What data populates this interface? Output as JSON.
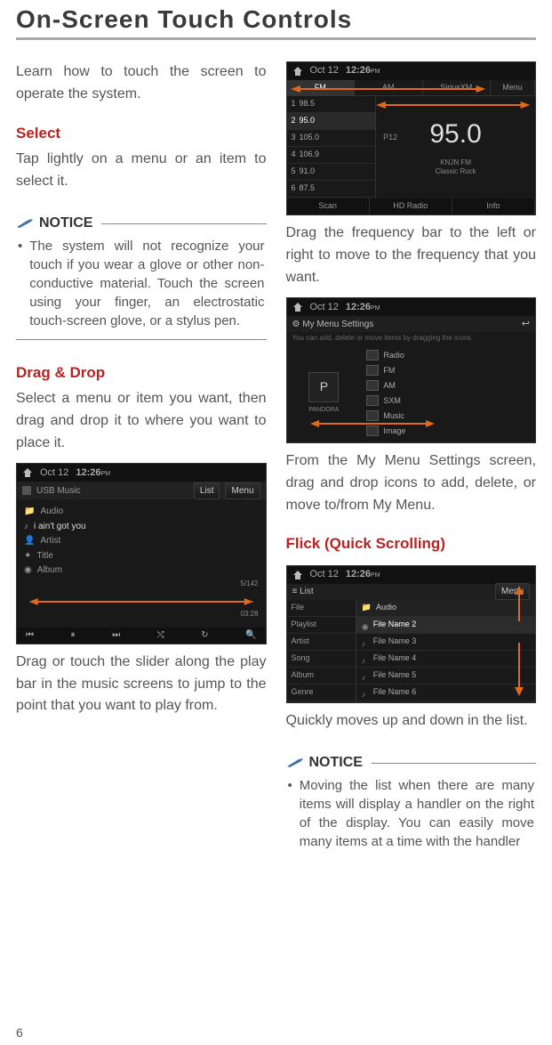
{
  "page": {
    "title": "On-Screen Touch Controls",
    "number": "6"
  },
  "left": {
    "intro": "Learn how to touch the screen to operate the system.",
    "select_title": "Select",
    "select_body": "Tap lightly on a menu or an item to select it.",
    "notice_label": "NOTICE",
    "notice1": "The system will not recognize your touch if you wear a glove or other non-conductive material. Touch the screen using your finger, an electrostatic touch-screen glove, or a stylus pen.",
    "drag_title": "Drag & Drop",
    "drag_body": "Select a menu or item you want, then drag and drop it to where you want to place it.",
    "drag_caption": "Drag or touch the slider along the play bar in the music screens to jump to the point that you want to play from."
  },
  "right": {
    "radio_caption": "Drag the frequency bar to the left or right to move to the frequency that you want.",
    "mymenu_caption": "From the My Menu Settings screen, drag and drop icons to add, delete, or move to/from My Menu.",
    "flick_title": "Flick (Quick Scrolling)",
    "flick_caption": "Quickly moves up and down in the list.",
    "notice_label": "NOTICE",
    "notice2": "Moving the list when there are many items will display a handler on the right of the display. You can easily move many items at a time with the handler"
  },
  "screens": {
    "date": "Oct 12",
    "time": "12:26",
    "ampm": "PM",
    "usb": {
      "source": "USB Music",
      "list_btn": "List",
      "menu_btn": "Menu",
      "cat": "Audio",
      "track": "i ain't got you",
      "meta": [
        "Artist",
        "Title",
        "Album"
      ],
      "count": "5/142",
      "elapsed": "03:28"
    },
    "radio": {
      "tabs": [
        "FM",
        "AM",
        "SiriusXM"
      ],
      "menu_btn": "Menu",
      "presets": [
        "98.5",
        "95.0",
        "105.0",
        "106.9",
        "91.0",
        "87.5"
      ],
      "preset_prefix": [
        "1",
        "2",
        "3",
        "4",
        "5",
        "6"
      ],
      "p12": "P12",
      "freq": "95.0",
      "sub1": "KNJN FM",
      "sub2": "Classic Rock",
      "bottom": [
        "Scan",
        "HD Radio",
        "Info"
      ]
    },
    "mymenu": {
      "title": "My Menu Settings",
      "hint": "You can add, delete or move items by dragging the icons.",
      "panel_label": "PANDORA",
      "items": [
        "Radio",
        "FM",
        "AM",
        "SXM",
        "Music",
        "Image"
      ]
    },
    "flick": {
      "list_btn": "List",
      "menu_btn": "Menu",
      "left": [
        "File",
        "Playlist",
        "Artist",
        "Song",
        "Album",
        "Genre"
      ],
      "head": "Audio",
      "rows": [
        "File Name 2",
        "File Name 3",
        "File Name 4",
        "File Name 5",
        "File Name 6"
      ]
    }
  }
}
